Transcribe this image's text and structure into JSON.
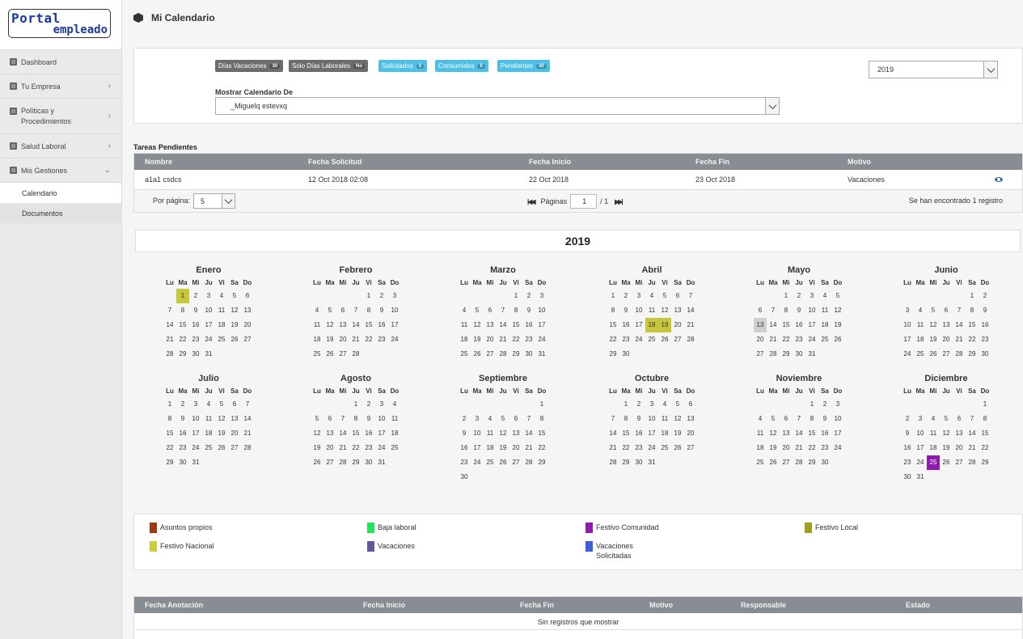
{
  "logo": {
    "line1": "Portal",
    "line2": "empleado"
  },
  "sidebar": {
    "items": [
      {
        "label": "Dashboard",
        "chevron": ""
      },
      {
        "label": "Tu Empresa",
        "chevron": "›"
      },
      {
        "label": "Políticas y Procedimientos",
        "chevron": "›"
      },
      {
        "label": "Salud Laboral",
        "chevron": "›"
      },
      {
        "label": "Mis Gestiones",
        "chevron": "⌄"
      }
    ],
    "subitems": [
      {
        "label": "Calendario"
      },
      {
        "label": "Documentos"
      }
    ]
  },
  "header": {
    "title": "Mi Calendario"
  },
  "filters": {
    "badges": [
      {
        "label": "Días Vacaciones",
        "count": "30"
      },
      {
        "label": "Solo Días Laborales",
        "count": "No"
      },
      {
        "label": "Solicitados",
        "count": "0"
      },
      {
        "label": "Consumidos",
        "count": "0"
      },
      {
        "label": "Pendientes",
        "count": "30"
      }
    ],
    "mostrar_label": "Mostrar Calendario De",
    "employee": "_Miguelq estevxq",
    "year": "2019"
  },
  "tareas": {
    "title": "Tareas Pendientes",
    "columns": [
      "Nombre",
      "Fecha Solicitud",
      "Fecha Inicio",
      "Fecha Fin",
      "Motivo"
    ],
    "rows": [
      {
        "nombre": "a1a1 csdcs",
        "fecha_solicitud": "12 Oct 2018 02:08",
        "fecha_inicio": "22 Oct 2018",
        "fecha_fin": "23 Oct 2018",
        "motivo": "Vacaciones"
      }
    ],
    "pager": {
      "per_page_label": "Por página:",
      "per_page": "5",
      "pages_label": "Páginas",
      "page": "1",
      "total": "/ 1",
      "found": "Se han encontrado 1 registro"
    }
  },
  "calendar": {
    "year": "2019",
    "dows": [
      "Lu",
      "Ma",
      "Mi",
      "Ju",
      "Vi",
      "Sa",
      "Do"
    ],
    "months": [
      {
        "name": "Enero",
        "start": 1,
        "days": 31,
        "hl": {
          "1": "local"
        }
      },
      {
        "name": "Febrero",
        "start": 4,
        "days": 28,
        "hl": {}
      },
      {
        "name": "Marzo",
        "start": 4,
        "days": 31,
        "hl": {}
      },
      {
        "name": "Abril",
        "start": 0,
        "days": 30,
        "hl": {
          "18": "local",
          "19": "local"
        }
      },
      {
        "name": "Mayo",
        "start": 2,
        "days": 31,
        "hl": {
          "13": "sel"
        }
      },
      {
        "name": "Junio",
        "start": 5,
        "days": 30,
        "hl": {}
      },
      {
        "name": "Julio",
        "start": 0,
        "days": 31,
        "hl": {}
      },
      {
        "name": "Agosto",
        "start": 3,
        "days": 31,
        "hl": {}
      },
      {
        "name": "Septiembre",
        "start": 6,
        "days": 30,
        "hl": {}
      },
      {
        "name": "Octubre",
        "start": 1,
        "days": 31,
        "hl": {}
      },
      {
        "name": "Noviembre",
        "start": 4,
        "days": 30,
        "hl": {}
      },
      {
        "name": "Diciembre",
        "start": 6,
        "days": 31,
        "hl": {
          "25": "com"
        }
      }
    ]
  },
  "legend": [
    {
      "label": "Asuntos propios",
      "color": "#9b3a12"
    },
    {
      "label": "Baja laboral",
      "color": "#23e35a"
    },
    {
      "label": "Festivo Comunidad",
      "color": "#8e1bab"
    },
    {
      "label": "Festivo Local",
      "color": "#a0a020"
    },
    {
      "label": "Festivo Nacional",
      "color": "#cdcd3a"
    },
    {
      "label": "Vacaciones",
      "color": "#5e5a9a"
    },
    {
      "label": "Vacaciones Solicitadas",
      "color": "#3d5ed8"
    }
  ],
  "anotaciones": {
    "columns": [
      "Fecha Anotación",
      "Fecha Inicio",
      "Fecha Fin",
      "Motivo",
      "Responsable",
      "Estado"
    ],
    "empty": "Sin registros que mostrar"
  }
}
